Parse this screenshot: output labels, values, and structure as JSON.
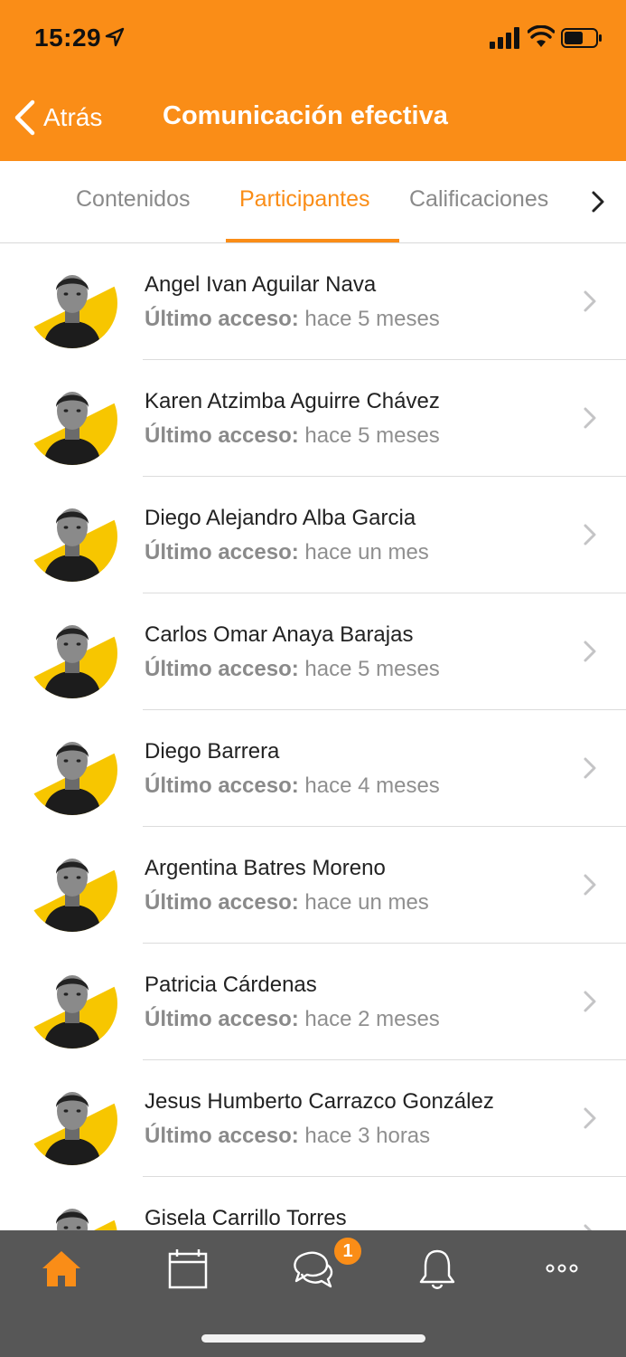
{
  "status_bar": {
    "time": "15:29"
  },
  "nav": {
    "back_label": "Atrás",
    "title": "Comunicación efectiva"
  },
  "tabs": [
    {
      "label": "Contenidos",
      "active": false
    },
    {
      "label": "Participantes",
      "active": true
    },
    {
      "label": "Calificaciones",
      "active": false
    }
  ],
  "access_label": "Último acceso:",
  "participants": [
    {
      "name": "Angel Ivan Aguilar Nava",
      "last_access": "hace 5 meses"
    },
    {
      "name": "Karen Atzimba Aguirre Chávez",
      "last_access": "hace 5 meses"
    },
    {
      "name": "Diego Alejandro Alba Garcia",
      "last_access": "hace un mes"
    },
    {
      "name": "Carlos Omar Anaya Barajas",
      "last_access": "hace 5 meses"
    },
    {
      "name": "Diego Barrera",
      "last_access": "hace 4 meses"
    },
    {
      "name": "Argentina Batres Moreno",
      "last_access": "hace un mes"
    },
    {
      "name": "Patricia Cárdenas",
      "last_access": "hace 2 meses"
    },
    {
      "name": "Jesus Humberto Carrazco González",
      "last_access": "hace 3 horas"
    },
    {
      "name": "Gisela Carrillo Torres",
      "last_access": ""
    }
  ],
  "tabbar": {
    "items": [
      {
        "icon": "home-icon",
        "active": true
      },
      {
        "icon": "calendar-icon",
        "active": false
      },
      {
        "icon": "chat-icon",
        "active": false,
        "badge": "1"
      },
      {
        "icon": "bell-icon",
        "active": false
      },
      {
        "icon": "more-icon",
        "active": false
      }
    ]
  },
  "colors": {
    "accent": "#FA8D17",
    "tabbar_bg": "#575757",
    "avatar_yellow": "#F7C600"
  }
}
